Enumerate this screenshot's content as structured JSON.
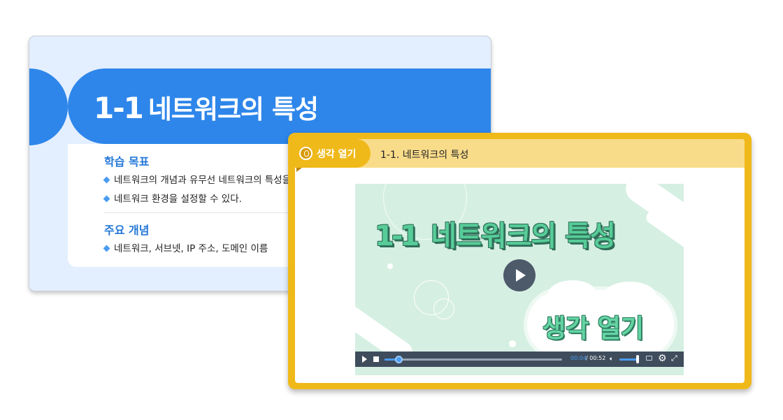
{
  "slide": {
    "title_number": "1-1",
    "title_text": "네트워크의 특성",
    "goals_heading": "학습 목표",
    "goals": [
      "네트워크의 개념과 유무선 네트워크의 특성을",
      "네트워크 환경을 설정할 수 있다."
    ],
    "concepts_heading": "주요 개념",
    "concepts": [
      "네트워크, 서브넷, IP 주소, 도메인 이름"
    ]
  },
  "popup": {
    "tab_label": "생각 열기",
    "title": "1-1. 네트워크의 특성",
    "video": {
      "title_number": "1-1",
      "title_text": "네트워크의 특성",
      "cloud_text": "생각 열기",
      "time_current": "00:04",
      "time_total": "/ 00:52",
      "progress": 0.077,
      "volume": 0.95
    }
  },
  "colors": {
    "slide_blue": "#2e86ea",
    "popup_gold": "#f0b91a",
    "video_mint": "#d6efe3",
    "progress_blue": "#4a9cf0"
  },
  "icons": {
    "tab": "lightbulb-icon",
    "play": "play-icon",
    "stop": "stop-icon",
    "volume": "volume-icon",
    "captions": "captions-icon",
    "settings": "gear-icon",
    "fullscreen": "fullscreen-icon"
  }
}
